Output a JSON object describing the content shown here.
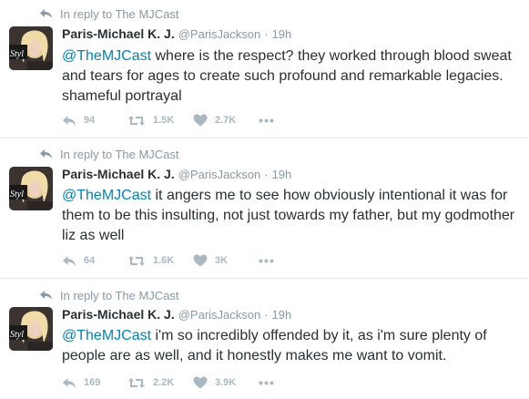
{
  "colors": {
    "name": "#292f33",
    "muted": "#8899a6",
    "mention": "#0084b4",
    "action": "#aab8c2",
    "divider": "#e1e8ed"
  },
  "icons": {
    "reply": "reply-arrow-icon",
    "retweet": "retweet-icon",
    "like": "heart-icon",
    "more": "more-dots-icon"
  },
  "tweets": [
    {
      "context": "In reply to The MJCast",
      "name": "Paris-Michael K. J.",
      "handle": "@ParisJackson",
      "separator": "·",
      "time": "19h",
      "mention": "@TheMJCast",
      "body": " where is the respect? they worked through blood sweat and tears for ages to create such profound and remarkable legacies. shameful portrayal",
      "replies": "94",
      "retweets": "1.5K",
      "likes": "2.7K"
    },
    {
      "context": "In reply to The MJCast",
      "name": "Paris-Michael K. J.",
      "handle": "@ParisJackson",
      "separator": "·",
      "time": "19h",
      "mention": "@TheMJCast",
      "body": " it angers me to see how obviously intentional it was for them to be this insulting, not just towards my father, but my godmother liz as well",
      "replies": "64",
      "retweets": "1.6K",
      "likes": "3K"
    },
    {
      "context": "In reply to The MJCast",
      "name": "Paris-Michael K. J.",
      "handle": "@ParisJackson",
      "separator": "·",
      "time": "19h",
      "mention": "@TheMJCast",
      "body": " i'm so incredibly offended by it, as i'm sure plenty of people are as well, and it honestly makes me want to vomit.",
      "replies": "169",
      "retweets": "2.2K",
      "likes": "3.9K"
    }
  ]
}
